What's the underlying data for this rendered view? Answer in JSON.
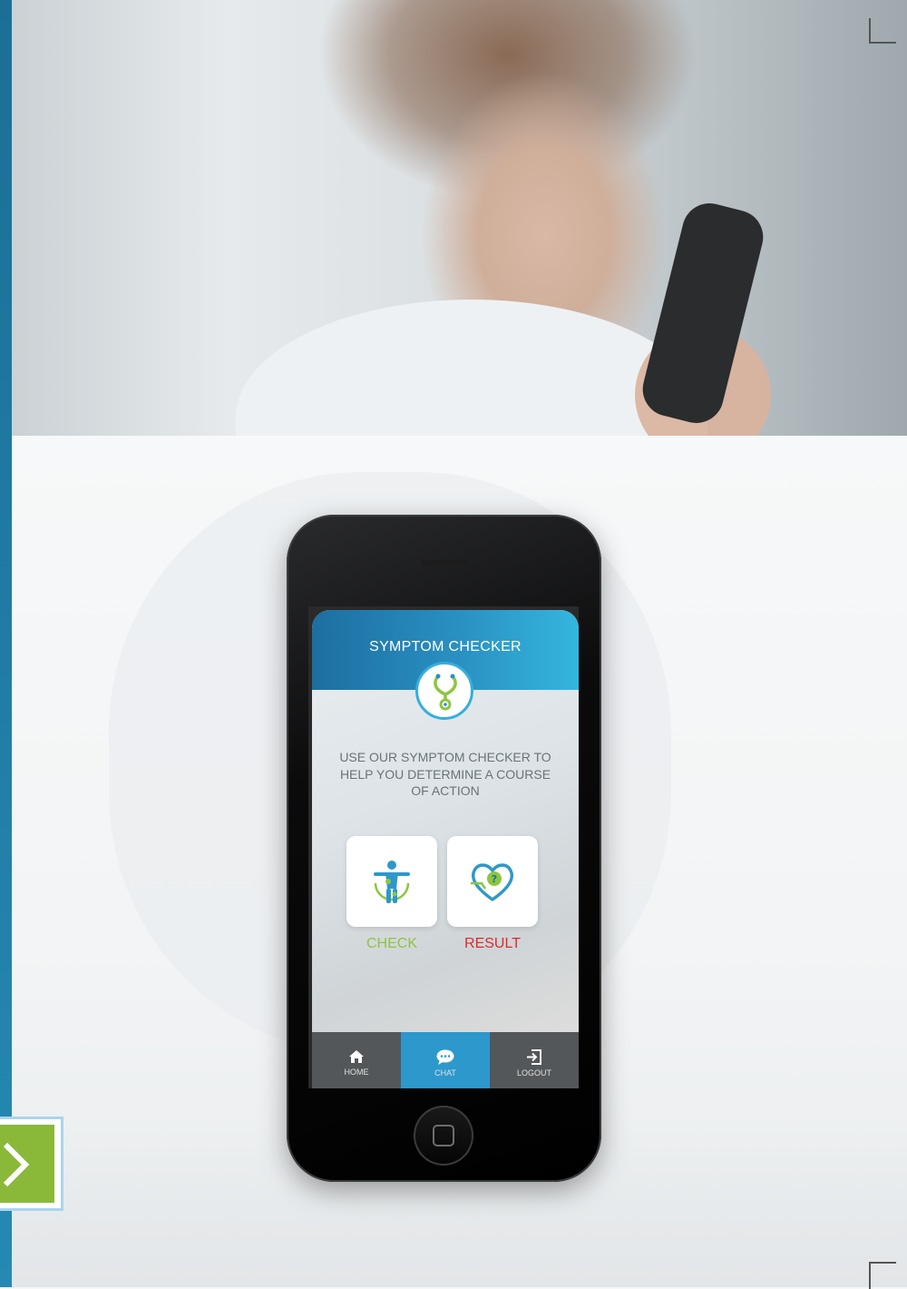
{
  "app": {
    "title": "SYMPTOM CHECKER",
    "tagline": "USE OUR SYMPTOM CHECKER TO HELP YOU DETERMINE A COURSE OF ACTION",
    "buttons": {
      "check_label": "CHECK",
      "result_label": "RESULT"
    },
    "nav": {
      "items": [
        {
          "label": "HOME",
          "icon": "home-icon",
          "active": false
        },
        {
          "label": "CHAT",
          "icon": "chat-icon",
          "active": true
        },
        {
          "label": "LOGOUT",
          "icon": "logout-icon",
          "active": false
        }
      ]
    }
  },
  "colors": {
    "brand_blue": "#2a90c2",
    "check_green": "#8cc63f",
    "result_red": "#e0292b",
    "nav_bg": "#545759",
    "nav_active": "#2d98cc",
    "arrow_green": "#8ab93a"
  },
  "icons": {
    "logo": "stethoscope-icon",
    "check": "body-figure-icon",
    "result": "heart-question-icon",
    "side_arrow": "chevron-right-icon"
  }
}
